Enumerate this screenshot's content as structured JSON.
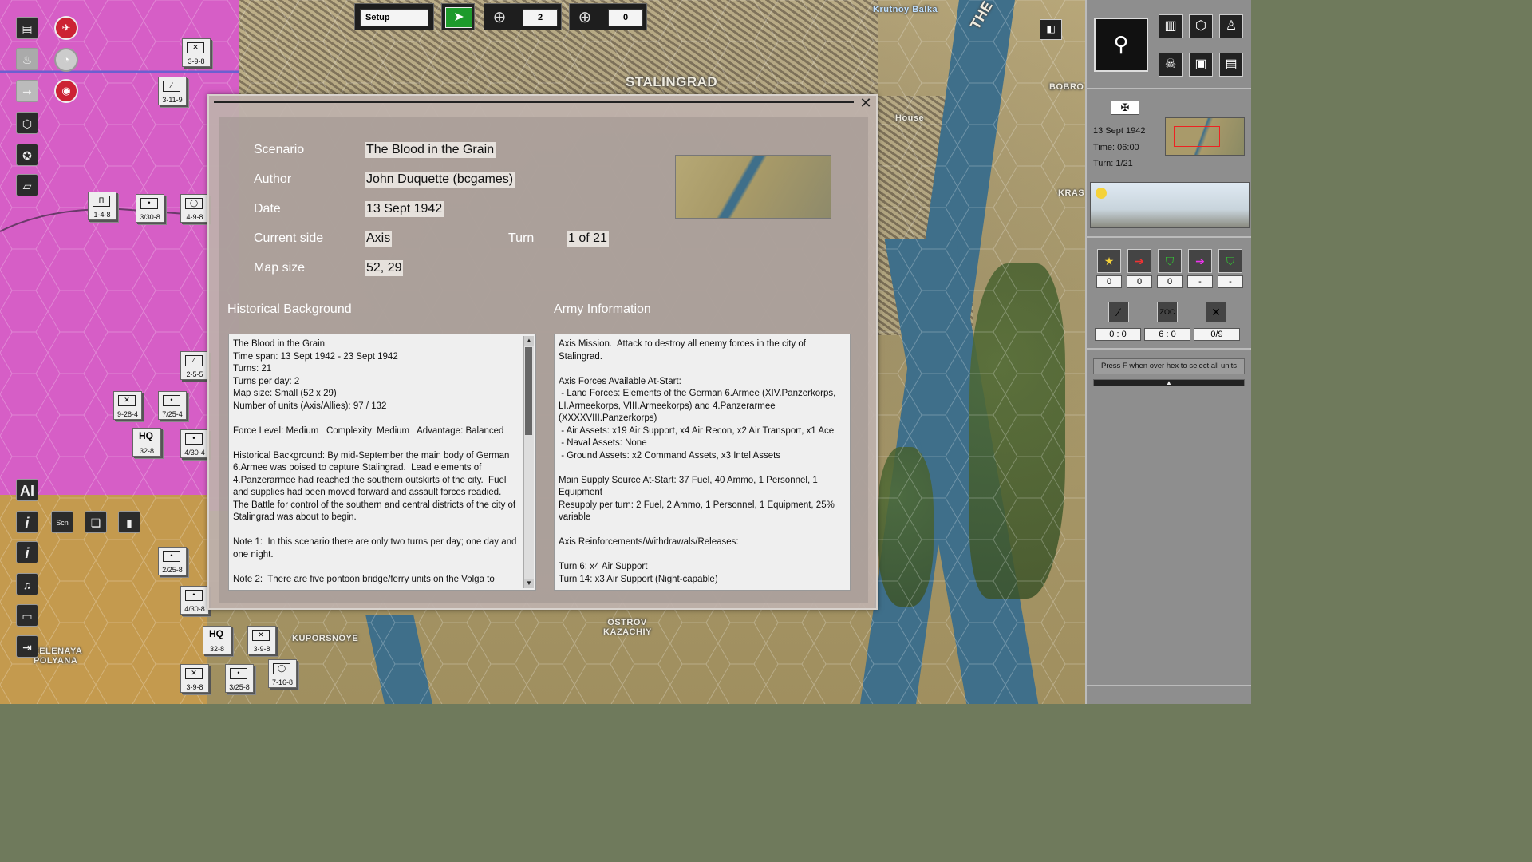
{
  "top_bar": {
    "phase_label": "Setup",
    "counter_a_value": "2",
    "counter_b_value": "0"
  },
  "map": {
    "labels": [
      "STALINGRAD",
      "Krutnoy Balka",
      "THE VOLGA",
      "BOBRO",
      "House",
      "KRAS",
      "OSTROV KAZACHIY",
      "KUPORSNOYE",
      "ZELENAYA POLYANA"
    ],
    "units": [
      {
        "label": "3-9-8"
      },
      {
        "label": "3-11-9"
      },
      {
        "label": "1-4-8"
      },
      {
        "label": "3/30-8"
      },
      {
        "label": "4-9-8"
      },
      {
        "label": "2-5-5"
      },
      {
        "label": "9-28-4"
      },
      {
        "label": "7/25-4"
      },
      {
        "label": "32-8"
      },
      {
        "label": "4/30-4"
      },
      {
        "label": "2/25-8"
      },
      {
        "label": "4/30-8"
      },
      {
        "label": "32-8"
      },
      {
        "label": "3-9-8"
      },
      {
        "label": "3-9-8"
      },
      {
        "label": "3/25-8"
      },
      {
        "label": "7-16-8"
      }
    ],
    "hq_text": "HQ"
  },
  "left_toolbar": {
    "ai_label": "AI",
    "info1_label": "i",
    "info2_label": "i",
    "scenario_icon_label": "Scn"
  },
  "dialog": {
    "fields": {
      "scenario_label": "Scenario",
      "scenario_value": "The Blood in the Grain",
      "author_label": "Author",
      "author_value": "John Duquette (bcgames)",
      "date_label": "Date",
      "date_value": "13 Sept 1942",
      "side_label": "Current side",
      "side_value": "Axis",
      "turn_label": "Turn",
      "turn_value": "1 of 21",
      "mapsize_label": "Map size",
      "mapsize_value": "52, 29"
    },
    "historical_title": "Historical Background",
    "historical_text": "The Blood in the Grain\nTime span: 13 Sept 1942 - 23 Sept 1942\nTurns: 21\nTurns per day: 2\nMap size: Small (52 x 29)\nNumber of units (Axis/Allies): 97 / 132\n\nForce Level: Medium   Complexity: Medium   Advantage: Balanced\n\nHistorical Background: By mid-September the main body of German 6.Armee was poised to capture Stalingrad.  Lead elements of 4.Panzerarmee had reached the southern outskirts of the city.  Fuel and supplies had been moved forward and assault forces readied. The Battle for control of the southern and central districts of the city of Stalingrad was about to begin.\n\nNote 1:  In this scenario there are only two turns per day; one day and one night.\n\nNote 2:  There are five pontoon bridge/ferry units on the Volga to",
    "army_title": "Army Information",
    "army_text": "Axis Mission.  Attack to destroy all enemy forces in the city of Stalingrad.\n\nAxis Forces Available At-Start:\n - Land Forces: Elements of the German 6.Armee (XIV.Panzerkorps, LI.Armeekorps, VIII.Armeekorps) and 4.Panzerarmee (XXXXVIII.Panzerkorps)\n - Air Assets: x19 Air Support, x4 Air Recon, x2 Air Transport, x1 Ace\n - Naval Assets: None\n - Ground Assets: x2 Command Assets, x3 Intel Assets\n\nMain Supply Source At-Start: 37 Fuel, 40 Ammo, 1 Personnel, 1 Equipment\nResupply per turn: 2 Fuel, 2 Ammo, 1 Personnel, 1 Equipment, 25% variable\n\nAxis Reinforcements/Withdrawals/Releases:\n\nTurn 6: x4 Air Support\nTurn 14: x3 Air Support (Night-capable)",
    "close_glyph": "✕"
  },
  "right_panel": {
    "date": "13 Sept 1942",
    "time": "Time: 06:00",
    "turn": "Turn: 1/21",
    "stats_row1": [
      "0",
      "0",
      "0",
      "-",
      "-"
    ],
    "stats_row2": [
      "0 : 0",
      "6 : 0",
      "0/9"
    ],
    "zoc_label": "ZOC",
    "hint": "Press F when over hex to select all units"
  },
  "colors": {
    "axis_zone": "#d65ec6",
    "volga": "#3f6f8a",
    "end_turn_green": "#1d9a2b"
  }
}
